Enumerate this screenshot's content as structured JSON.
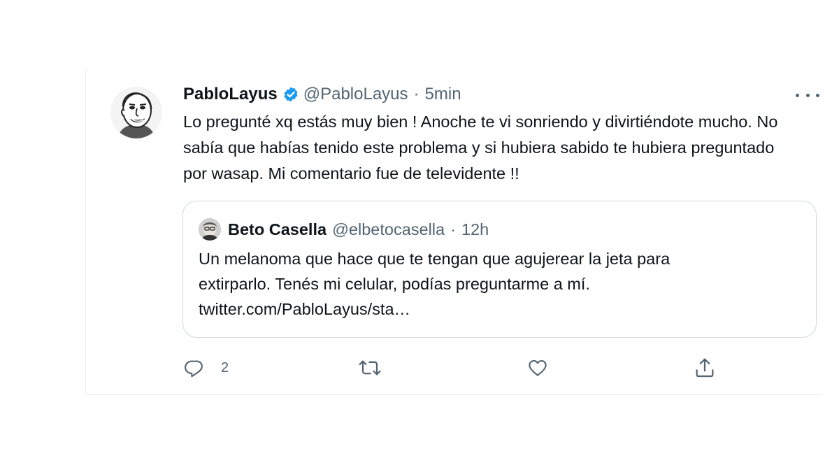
{
  "tweet": {
    "display_name": "PabloLayus",
    "verified": true,
    "handle": "@PabloLayus",
    "separator": "·",
    "time": "5min",
    "text": "Lo pregunté xq estás muy bien ! Anoche te vi sonriendo y divirtiéndote mucho. No sabía que habías tenido este problema y si hubiera sabido te hubiera preguntado por wasap. Mi comentario fue de televidente !!",
    "avatar_icon": "caricature-avatar"
  },
  "quote": {
    "display_name": "Beto Casella",
    "handle": "@elbetocasella",
    "separator": "·",
    "time": "12h",
    "text_line1": "Un melanoma que hace que te tengan que agujerear la jeta para",
    "text_line2": "extirparlo. Tenés mi celular, podías preguntarme a mí.",
    "text_line3": "twitter.com/PabloLayus/sta…",
    "avatar_icon": "photo-avatar"
  },
  "actions": {
    "reply_count": "2",
    "icons": [
      "reply-icon",
      "retweet-icon",
      "like-icon",
      "share-icon"
    ]
  },
  "colors": {
    "verified_blue": "#1d9bf0",
    "secondary_text": "#536471",
    "primary_text": "#0f1419",
    "border": "#cfd9de"
  }
}
